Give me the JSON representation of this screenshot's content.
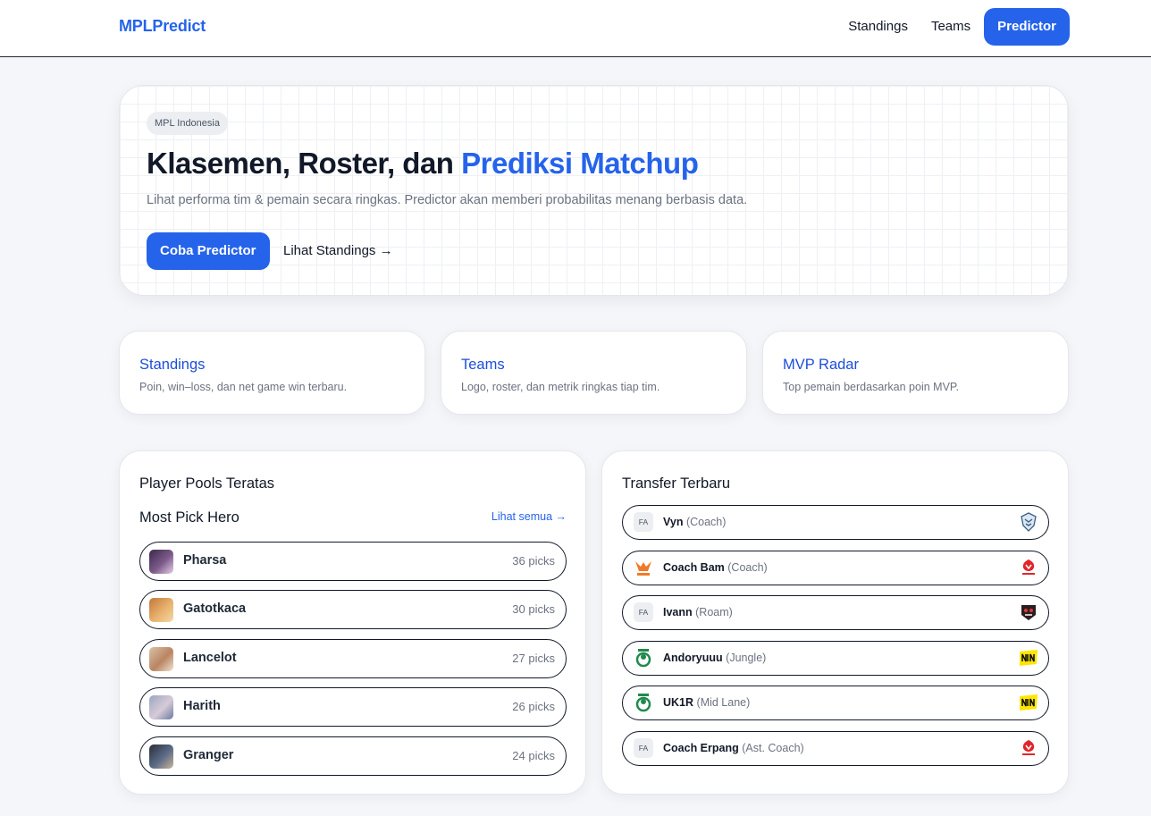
{
  "header": {
    "brand": "MPLPredict",
    "nav": [
      "Standings",
      "Teams"
    ],
    "nav_active": "Predictor"
  },
  "hero": {
    "badge": "MPL Indonesia",
    "title_prefix": "Klasemen, Roster, dan ",
    "title_accent": "Prediksi Matchup",
    "subtitle": "Lihat performa tim & pemain secara ringkas. Predictor akan memberi probabilitas menang berbasis data.",
    "cta_primary": "Coba Predictor",
    "cta_secondary": "Lihat Standings →"
  },
  "features": [
    {
      "title": "Standings",
      "desc": "Poin, win–loss, dan net game win terbaru."
    },
    {
      "title": "Teams",
      "desc": "Logo, roster, dan metrik ringkas tiap tim."
    },
    {
      "title": "MVP Radar",
      "desc": "Top pemain berdasarkan poin MVP."
    }
  ],
  "player_pools": {
    "title": "Player Pools Teratas",
    "subtitle": "Most Pick Hero",
    "see_all": "Lihat semua →",
    "heroes": [
      {
        "name": "Pharsa",
        "picks": "36 picks"
      },
      {
        "name": "Gatotkaca",
        "picks": "30 picks"
      },
      {
        "name": "Lancelot",
        "picks": "27 picks"
      },
      {
        "name": "Harith",
        "picks": "26 picks"
      },
      {
        "name": "Granger",
        "picks": "24 picks"
      }
    ]
  },
  "transfers": {
    "title": "Transfer Terbaru",
    "items": [
      {
        "from": "FA",
        "name": "Vyn",
        "role": "(Coach)",
        "from_logo": "none",
        "to_logo": "evos-logo"
      },
      {
        "from": "",
        "name": "Coach Bam",
        "role": "(Coach)",
        "from_logo": "rebellion-logo",
        "to_logo": "vitality-logo"
      },
      {
        "from": "FA",
        "name": "Ivann",
        "role": "(Roam)",
        "from_logo": "none",
        "to_logo": "geek-fam-logo"
      },
      {
        "from": "",
        "name": "Andoryuuu",
        "role": "(Jungle)",
        "from_logo": "green-team-logo",
        "to_logo": "navi-logo"
      },
      {
        "from": "",
        "name": "UK1R",
        "role": "(Mid Lane)",
        "from_logo": "green-team-logo",
        "to_logo": "navi-logo"
      },
      {
        "from": "FA",
        "name": "Coach Erpang",
        "role": "(Ast. Coach)",
        "from_logo": "none",
        "to_logo": "vitality-logo"
      }
    ]
  },
  "colors": {
    "accent": "#2563eb",
    "text": "#111827",
    "muted": "#6b7280",
    "badge_bg": "#eceef2"
  }
}
